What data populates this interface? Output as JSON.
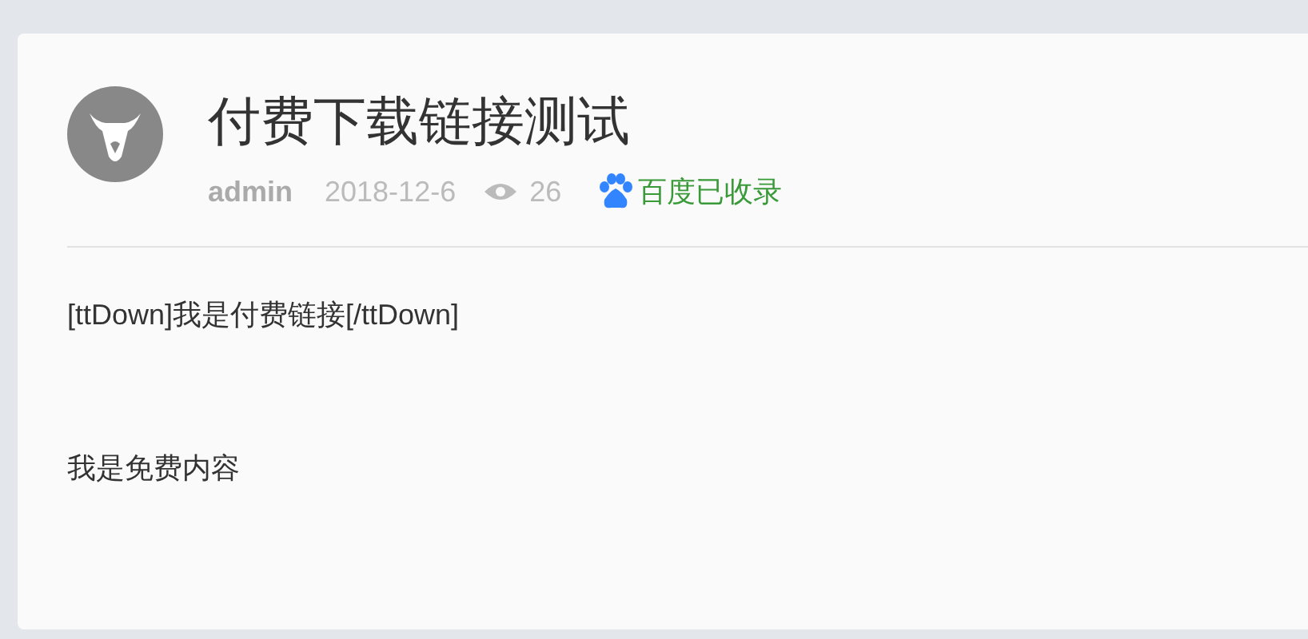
{
  "post": {
    "title": "付费下载链接测试",
    "author": "admin",
    "date": "2018-12-6",
    "views": "26",
    "indexed_label": "百度已收录"
  },
  "content": [
    "[ttDown]我是付费链接[/ttDown]",
    "我是免费内容"
  ]
}
